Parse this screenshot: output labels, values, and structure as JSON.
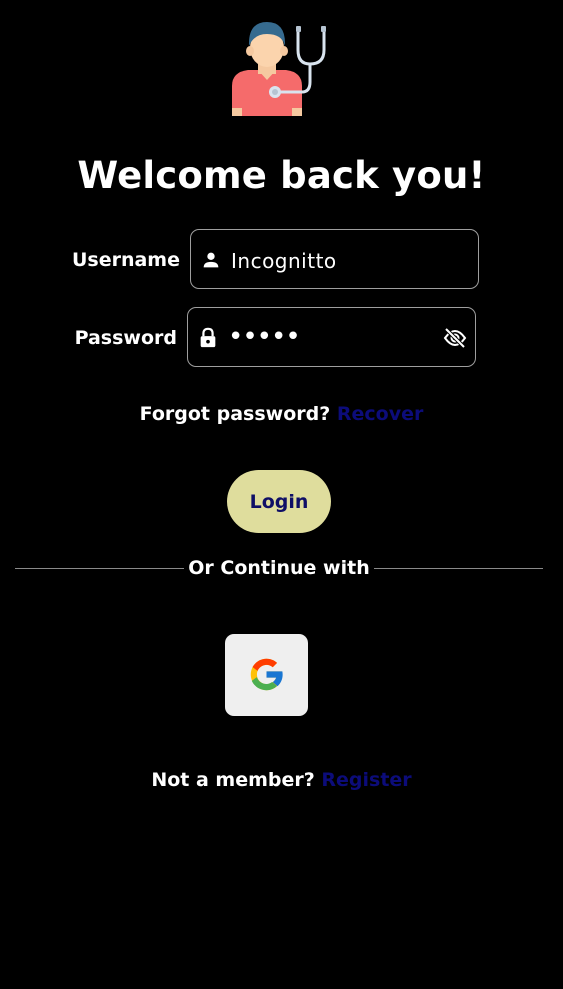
{
  "header": {
    "logo_icon": "doctor-with-stethoscope-icon",
    "title": "Welcome back you!"
  },
  "form": {
    "username": {
      "label": "Username",
      "value": "Incognitto",
      "icon": "person-icon"
    },
    "password": {
      "label": "Password",
      "value": "•••••",
      "icon": "lock-icon",
      "toggle_icon": "eye-off-icon"
    }
  },
  "forgot": {
    "text": "Forgot password?",
    "link": "Recover"
  },
  "login_button": "Login",
  "divider_text": "Or Continue with",
  "social": {
    "google_icon": "google-icon"
  },
  "register": {
    "text": "Not a member?",
    "link": "Register"
  },
  "colors": {
    "background": "#000000",
    "text": "#ffffff",
    "link": "#0c0c7a",
    "login_bg": "#dfdd9d",
    "login_text": "#0f0f66",
    "field_border": "#9e9e9e",
    "google_bg": "#efefef"
  }
}
